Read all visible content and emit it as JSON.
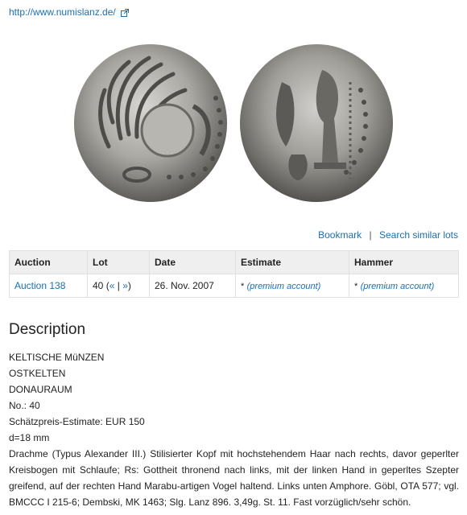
{
  "source_link": {
    "url_text": "http://www.numislanz.de/"
  },
  "actions": {
    "bookmark": "Bookmark",
    "separator": "|",
    "search_similar": "Search similar lots"
  },
  "table": {
    "headers": [
      "Auction",
      "Lot",
      "Date",
      "Estimate",
      "Hammer"
    ],
    "row": {
      "auction": "Auction 138",
      "lot_number": "40",
      "lot_nav_open": "(",
      "lot_prev": "«",
      "lot_nav_sep": "|",
      "lot_next": "»",
      "lot_nav_close": ")",
      "date": "26. Nov. 2007",
      "estimate_star": "*",
      "estimate_link": "(premium account)",
      "hammer_star": "*",
      "hammer_link": "(premium account)"
    }
  },
  "description": {
    "heading": "Description",
    "lines": [
      "KELTISCHE MüNZEN",
      "OSTKELTEN",
      "DONAURAUM",
      "No.: 40",
      "Schätzpreis-Estimate: EUR 150",
      "d=18 mm"
    ],
    "paragraph": "Drachme (Typus Alexander III.) Stilisierter Kopf mit hochstehendem Haar nach rechts, davor geperlter Kreisbogen mit Schlaufe; Rs: Gottheit thronend nach links, mit der linken Hand in geperltes Szepter greifend, auf der rechten Hand Marabu-artigen Vogel haltend. Links unten Amphore. Göbl, OTA 577; vgl. BMCCC I 215-6; Dembski, MK 1463; Slg. Lanz 896. 3,49g. St. 11. Fast vorzüglich/sehr schön."
  }
}
